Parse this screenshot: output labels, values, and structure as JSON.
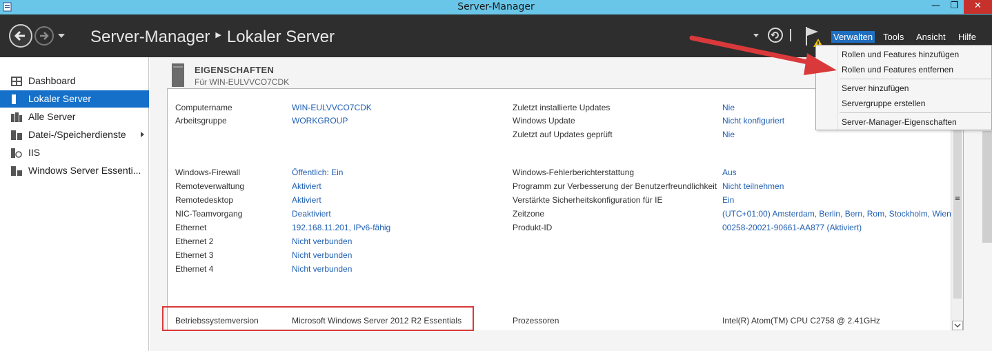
{
  "window": {
    "title": "Server-Manager",
    "minimize": "—",
    "maximize": "❐",
    "close": "✕"
  },
  "header": {
    "breadcrumb_root": "Server-Manager",
    "breadcrumb_sep": "▶",
    "breadcrumb_current": "Lokaler Server",
    "menus": {
      "verwalten": "Verwalten",
      "tools": "Tools",
      "ansicht": "Ansicht",
      "hilfe": "Hilfe"
    }
  },
  "sidebar": {
    "items": [
      {
        "label": "Dashboard",
        "icon": "dashboard-icon"
      },
      {
        "label": "Lokaler Server",
        "icon": "local-server-icon",
        "active": true
      },
      {
        "label": "Alle Server",
        "icon": "all-servers-icon"
      },
      {
        "label": "Datei-/Speicherdienste",
        "icon": "file-storage-icon",
        "has_submenu": true
      },
      {
        "label": "IIS",
        "icon": "iis-icon"
      },
      {
        "label": "Windows Server Essenti...",
        "icon": "essentials-icon"
      }
    ]
  },
  "tile": {
    "title": "EIGENSCHAFTEN",
    "subtitle": "Für WIN-EULVVCO7CDK"
  },
  "properties_left": [
    {
      "label": "Computername",
      "value": "WIN-EULVVCO7CDK"
    },
    {
      "label": "Arbeitsgruppe",
      "value": "WORKGROUP"
    },
    {
      "label": "Windows-Firewall",
      "value": "Öffentlich: Ein"
    },
    {
      "label": "Remoteverwaltung",
      "value": "Aktiviert"
    },
    {
      "label": "Remotedesktop",
      "value": "Aktiviert"
    },
    {
      "label": "NIC-Teamvorgang",
      "value": "Deaktiviert"
    },
    {
      "label": "Ethernet",
      "value": "192.168.11.201, IPv6-fähig"
    },
    {
      "label": "Ethernet 2",
      "value": "Nicht verbunden"
    },
    {
      "label": "Ethernet 3",
      "value": "Nicht verbunden"
    },
    {
      "label": "Ethernet 4",
      "value": "Nicht verbunden"
    },
    {
      "label": "Betriebssystemversion",
      "value": "Microsoft Windows Server 2012 R2 Essentials"
    }
  ],
  "properties_right": [
    {
      "label": "Zuletzt installierte Updates",
      "value": "Nie"
    },
    {
      "label": "Windows Update",
      "value": "Nicht konfiguriert"
    },
    {
      "label": "Zuletzt auf Updates geprüft",
      "value": "Nie"
    },
    {
      "label": "Windows-Fehlerberichterstattung",
      "value": "Aus"
    },
    {
      "label": "Programm zur Verbesserung der Benutzerfreundlichkeit",
      "value": "Nicht teilnehmen"
    },
    {
      "label": "Verstärkte Sicherheitskonfiguration für IE",
      "value": "Ein"
    },
    {
      "label": "Zeitzone",
      "value": "(UTC+01:00) Amsterdam, Berlin, Bern, Rom, Stockholm, Wien"
    },
    {
      "label": "Produkt-ID",
      "value": "00258-20021-90661-AA877 (Aktiviert)"
    },
    {
      "label": "Prozessoren",
      "value": "Intel(R) Atom(TM) CPU  C2758  @ 2.41GHz"
    }
  ],
  "manage_menu": {
    "items": [
      "Rollen und Features hinzufügen",
      "Rollen und Features entfernen",
      "Server hinzufügen",
      "Servergruppe erstellen",
      "Server-Manager-Eigenschaften"
    ]
  },
  "colors": {
    "titlebar": "#69c6e8",
    "header": "#2e2e2e",
    "accent": "#1570c9",
    "link": "#1f5fb2",
    "annotation": "#d9393a"
  }
}
